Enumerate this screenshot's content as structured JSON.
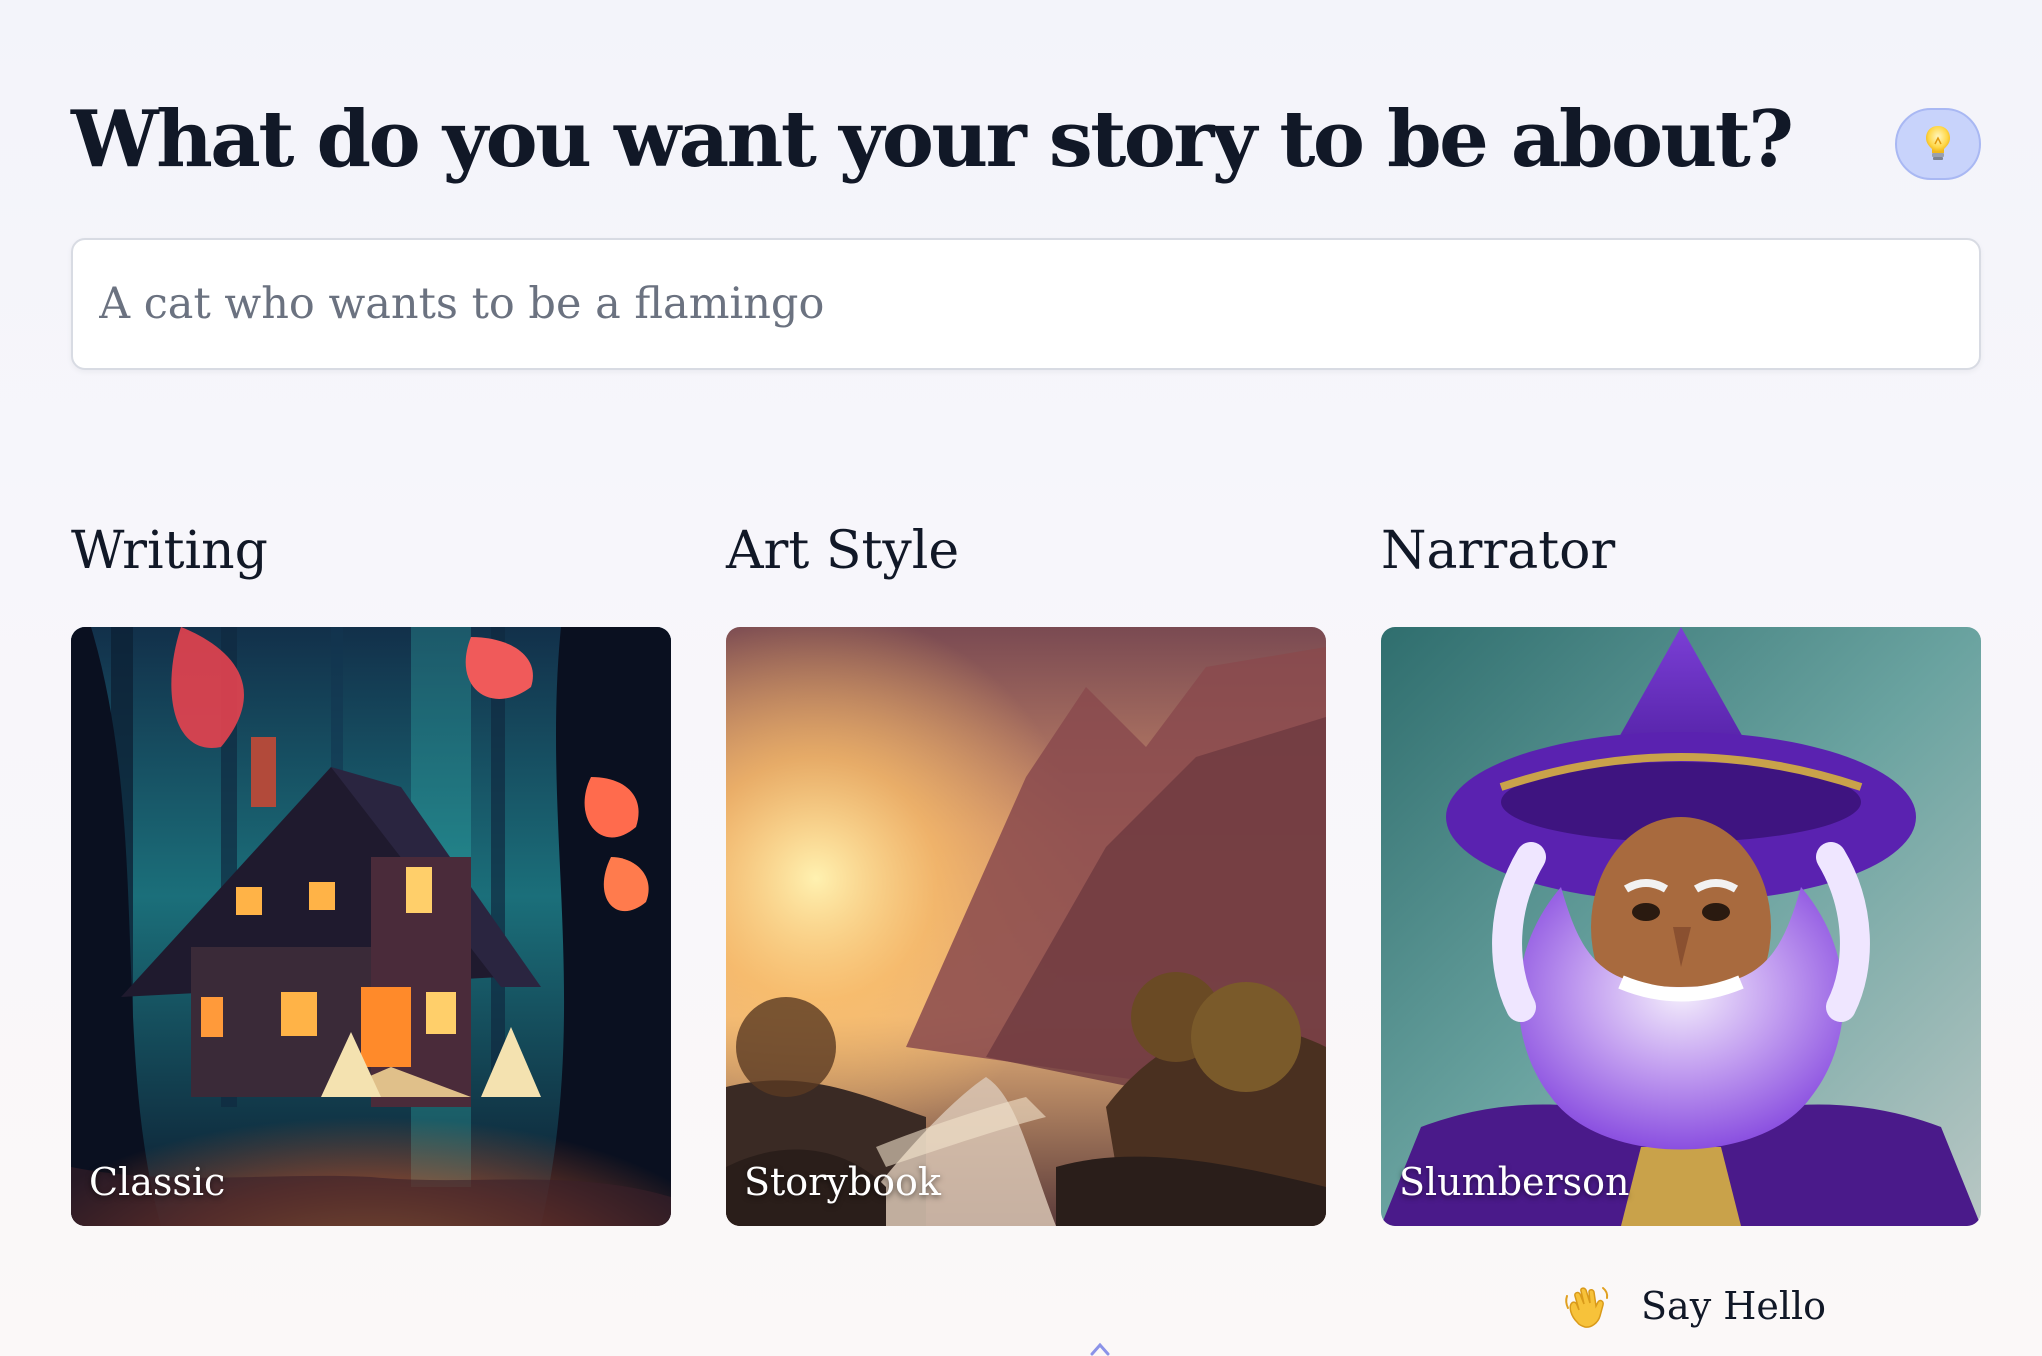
{
  "header": {
    "title": "What do you want your story to be about?",
    "idea_button_icon": "lightbulb-icon"
  },
  "prompt": {
    "placeholder": "A cat who wants to be a flamingo",
    "value": ""
  },
  "options": {
    "writing": {
      "title": "Writing",
      "selected_label": "Classic",
      "image": "forest cottage illustration"
    },
    "art_style": {
      "title": "Art Style",
      "selected_label": "Storybook",
      "image": "sunset valley with river"
    },
    "narrator": {
      "title": "Narrator",
      "selected_label": "Slumberson",
      "image": "wizard portrait"
    }
  },
  "footer": {
    "say_hello_icon": "waving-hand-icon",
    "say_hello_label": "Say Hello"
  },
  "colors": {
    "title": "#111827",
    "placeholder": "#6b7280",
    "idea_button_bg": "#c8d3fb",
    "input_border": "#d8dbe3"
  }
}
